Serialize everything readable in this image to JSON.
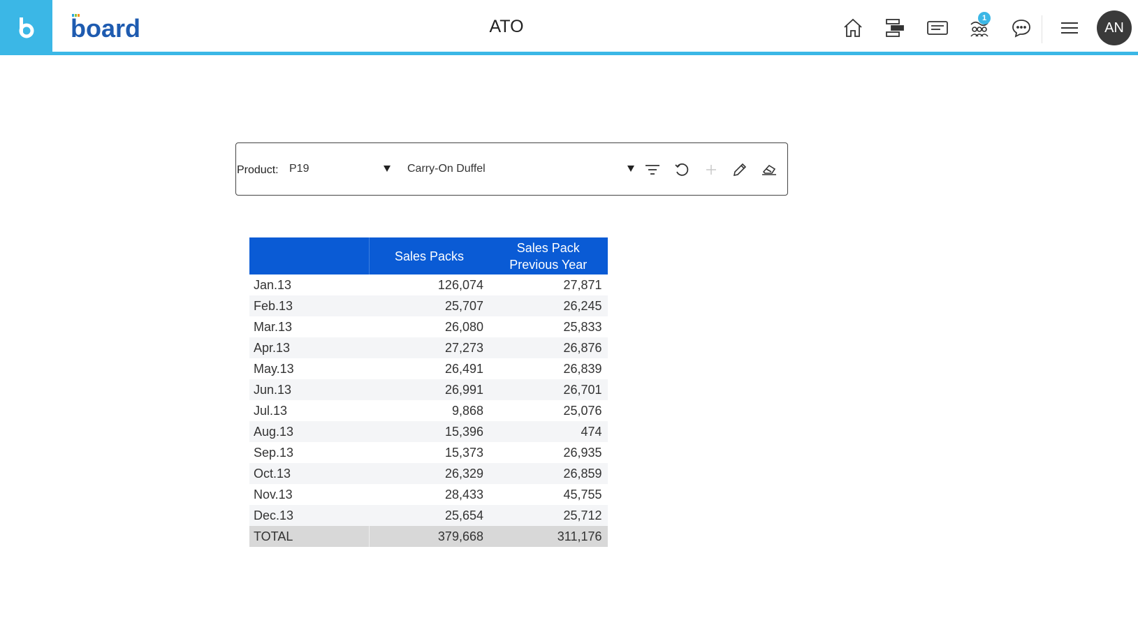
{
  "header": {
    "brand_letter": "b",
    "logo_text": "board",
    "title": "ATO",
    "notifications_count": "1",
    "user_initials": "AN"
  },
  "icons": {
    "home": "home-icon",
    "navigator": "navigator-icon",
    "screens": "screens-icon",
    "collaboration": "collaboration-icon",
    "comments": "chat-icon",
    "menu": "menu-icon"
  },
  "selector": {
    "label": "Product:",
    "code": "P19",
    "name": "Carry-On Duffel"
  },
  "table": {
    "columns": [
      "",
      "Sales Packs",
      "Sales Pack Previous Year"
    ],
    "rows": [
      {
        "label": "Jan.13",
        "sales": "126,074",
        "prev": "27,871"
      },
      {
        "label": "Feb.13",
        "sales": "25,707",
        "prev": "26,245"
      },
      {
        "label": "Mar.13",
        "sales": "26,080",
        "prev": "25,833"
      },
      {
        "label": "Apr.13",
        "sales": "27,273",
        "prev": "26,876"
      },
      {
        "label": "May.13",
        "sales": "26,491",
        "prev": "26,839"
      },
      {
        "label": "Jun.13",
        "sales": "26,991",
        "prev": "26,701"
      },
      {
        "label": "Jul.13",
        "sales": "9,868",
        "prev": "25,076"
      },
      {
        "label": "Aug.13",
        "sales": "15,396",
        "prev": "474"
      },
      {
        "label": "Sep.13",
        "sales": "15,373",
        "prev": "26,935"
      },
      {
        "label": "Oct.13",
        "sales": "26,329",
        "prev": "26,859"
      },
      {
        "label": "Nov.13",
        "sales": "28,433",
        "prev": "45,755"
      },
      {
        "label": "Dec.13",
        "sales": "25,654",
        "prev": "25,712"
      }
    ],
    "total": {
      "label": "TOTAL",
      "sales": "379,668",
      "prev": "311,176"
    }
  },
  "colors": {
    "accent": "#3bb7e6",
    "header_blue": "#0a5bd5",
    "total_row": "#d8d8d8"
  }
}
